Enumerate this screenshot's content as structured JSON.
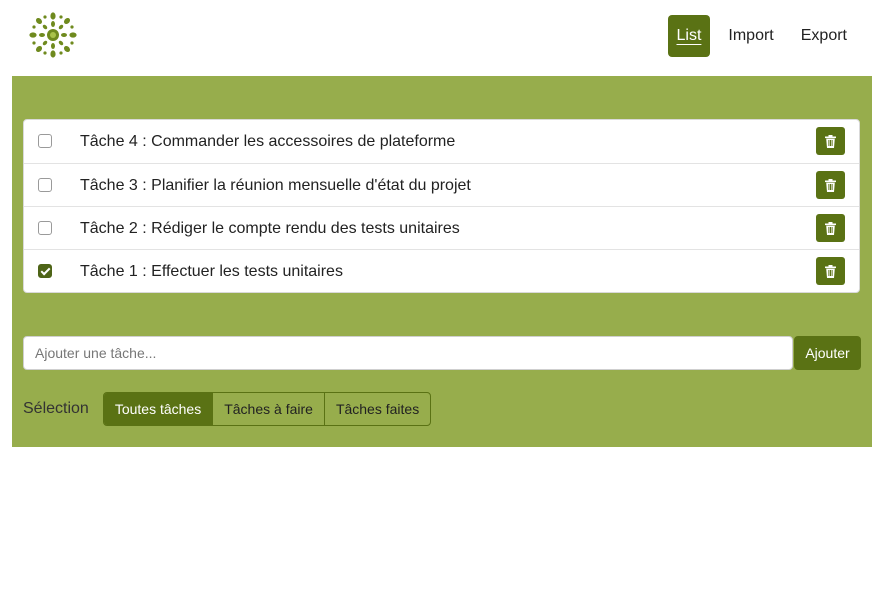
{
  "header": {
    "logo_icon": "sunburst-logo-icon",
    "nav": [
      {
        "label": "List",
        "active": true
      },
      {
        "label": "Import",
        "active": false
      },
      {
        "label": "Export",
        "active": false
      }
    ]
  },
  "tasks": [
    {
      "label": "Tâche 4 : Commander les accessoires de plateforme",
      "done": false,
      "delete_icon": "trash-icon"
    },
    {
      "label": "Tâche 3 : Planifier la réunion mensuelle d'état du projet",
      "done": false,
      "delete_icon": "trash-icon"
    },
    {
      "label": "Tâche 2 : Rédiger le compte rendu des tests unitaires",
      "done": false,
      "delete_icon": "trash-icon"
    },
    {
      "label": "Tâche 1 : Effectuer les tests unitaires",
      "done": true,
      "delete_icon": "trash-icon"
    }
  ],
  "add": {
    "placeholder": "Ajouter une tâche...",
    "value": "",
    "button_label": "Ajouter"
  },
  "filter": {
    "label": "Sélection",
    "options": [
      {
        "label": "Toutes tâches",
        "active": true
      },
      {
        "label": "Tâches à faire",
        "active": false
      },
      {
        "label": "Tâches faites",
        "active": false
      }
    ]
  },
  "colors": {
    "accent": "#5a7214",
    "panel": "#97ad4c"
  }
}
